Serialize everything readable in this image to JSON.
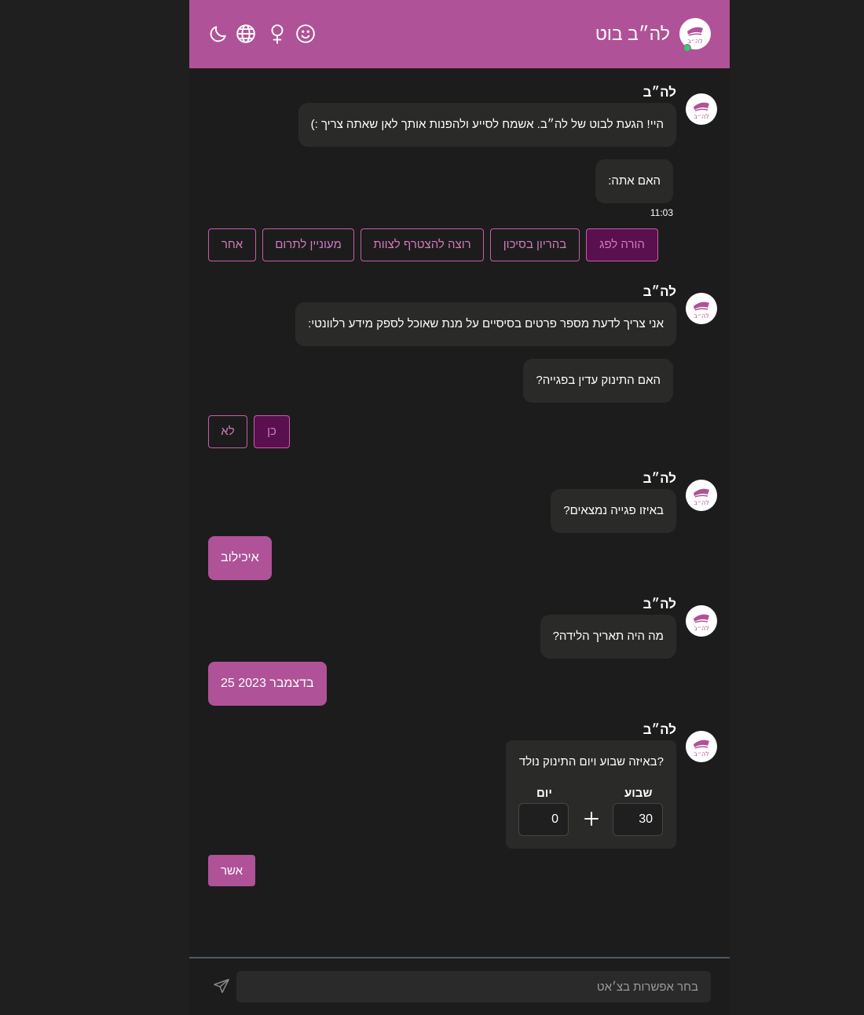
{
  "header": {
    "title": "לה״ב בוט",
    "icons": [
      "moon-icon",
      "globe-icon",
      "female-icon",
      "smiley-icon"
    ]
  },
  "colors": {
    "brand": "#b05297",
    "background": "#1c1c1c",
    "bubble": "#2a2a28",
    "selected_option": "#5a0f4f",
    "online": "#2bd067"
  },
  "bot": {
    "name": "לה״ב",
    "logo_text": "לה״ב"
  },
  "messages": {
    "greeting": "היי! הגעת לבוט של לה״ב. אשמח לסייע ולהפנות אותך לאן שאתה צריך :)",
    "are_you": "האם אתה:",
    "time": "11:03",
    "details_intro": "אני צריך לדעת מספר פרטים בסיסיים על מנת שאוכל לספק מידע רלוונטי:",
    "in_nicu": "האם התינוק עדין בפגייה?",
    "which_nicu": "באיזו פגייה נמצאים?",
    "birth_date_q": "מה היה תאריך הלידה?",
    "gest_age_q": "באיזה שבוע ויום התינוק נולד?"
  },
  "options_role": [
    "הורה לפג",
    "בהריון בסיכון",
    "רוצה להצטרף לצוות",
    "מעוניין לתרום",
    "אחר"
  ],
  "options_yesno": [
    "כן",
    "לא"
  ],
  "user_answers": {
    "nicu": "איכילוב",
    "birth_date": "25 בדצמבר 2023"
  },
  "gest_age": {
    "week_label": "שבוע",
    "day_label": "יום",
    "week_value": "30",
    "day_value": "0"
  },
  "confirm_label": "אשר",
  "composer": {
    "placeholder": "בחר אפשרות בצ׳אט"
  }
}
